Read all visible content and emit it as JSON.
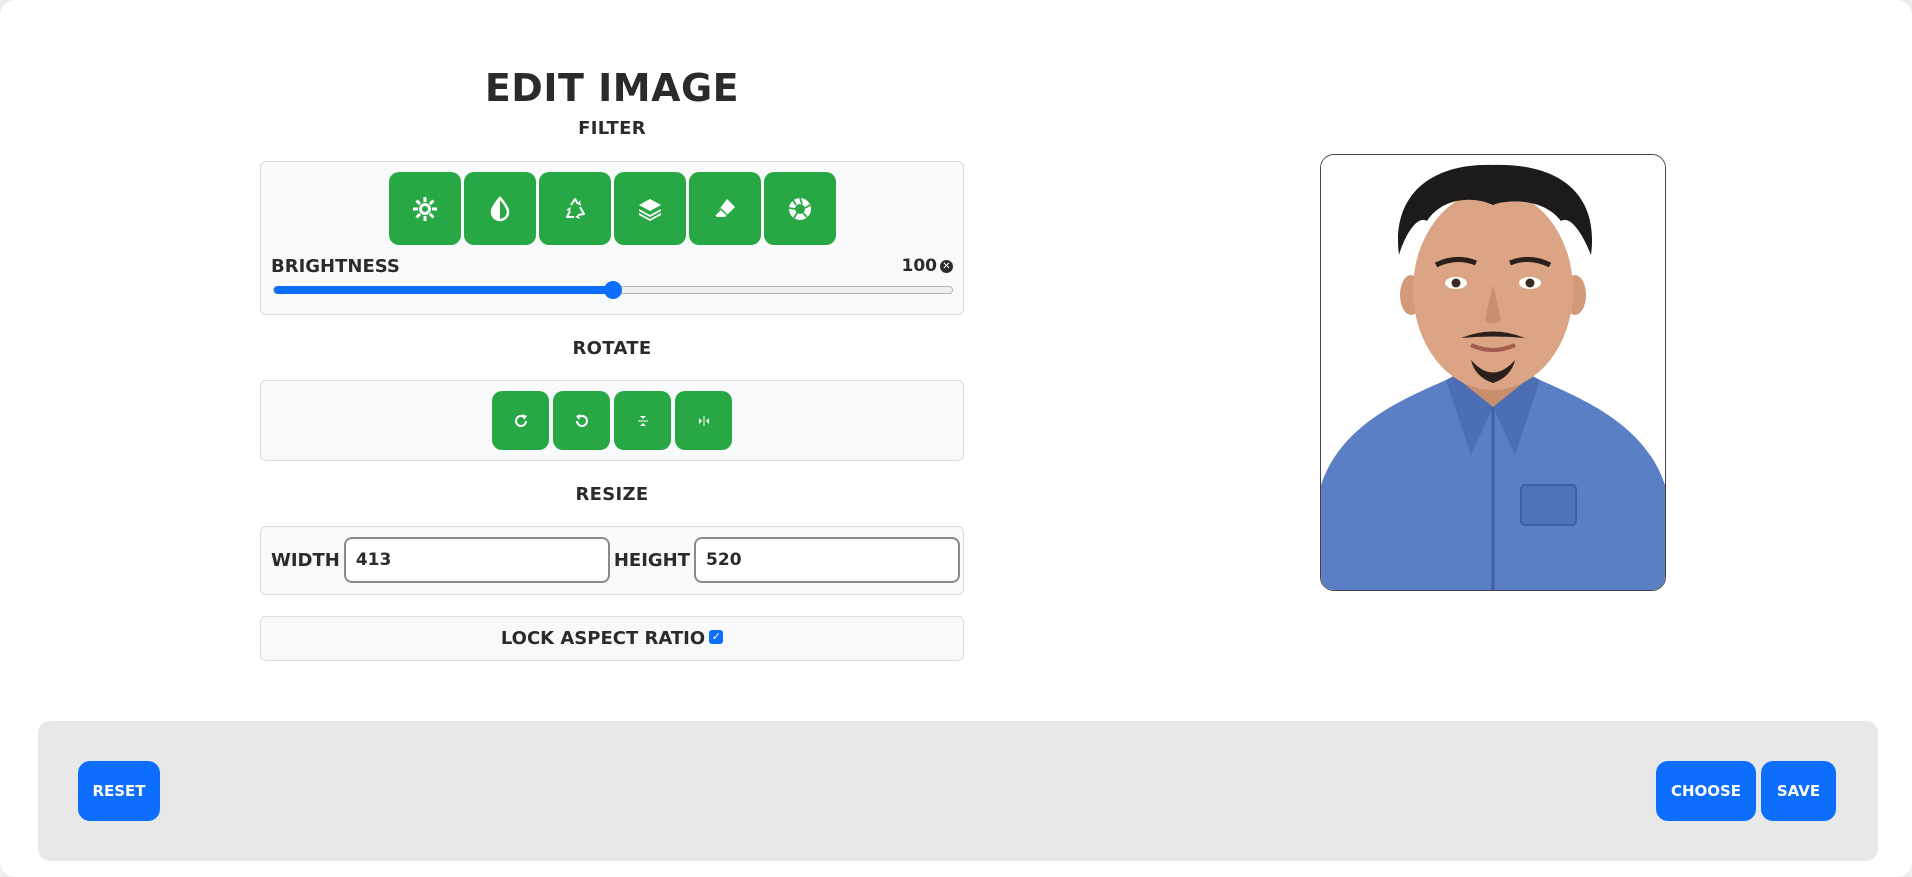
{
  "title": "EDIT IMAGE",
  "filter": {
    "label": "FILTER",
    "buttons": [
      {
        "icon": "brightness-icon"
      },
      {
        "icon": "contrast-icon"
      },
      {
        "icon": "recycle-icon"
      },
      {
        "icon": "layers-icon"
      },
      {
        "icon": "eraser-icon"
      },
      {
        "icon": "aperture-icon"
      }
    ],
    "active_filter": "BRIGHTNESS",
    "value": "100",
    "slider_fraction": 0.5
  },
  "rotate": {
    "label": "ROTATE",
    "buttons": [
      {
        "icon": "rotate-right-icon"
      },
      {
        "icon": "rotate-left-icon"
      },
      {
        "icon": "flip-vertical-icon"
      },
      {
        "icon": "flip-horizontal-icon"
      }
    ]
  },
  "resize": {
    "label": "RESIZE",
    "width_label": "WIDTH",
    "width_value": "413",
    "height_label": "HEIGHT",
    "height_value": "520"
  },
  "lock": {
    "label": "LOCK ASPECT RATIO",
    "checked": true
  },
  "footer": {
    "reset_label": "RESET",
    "choose_label": "CHOOSE",
    "save_label": "SAVE"
  },
  "colors": {
    "green": "#28a745",
    "blue": "#0d6efd"
  }
}
